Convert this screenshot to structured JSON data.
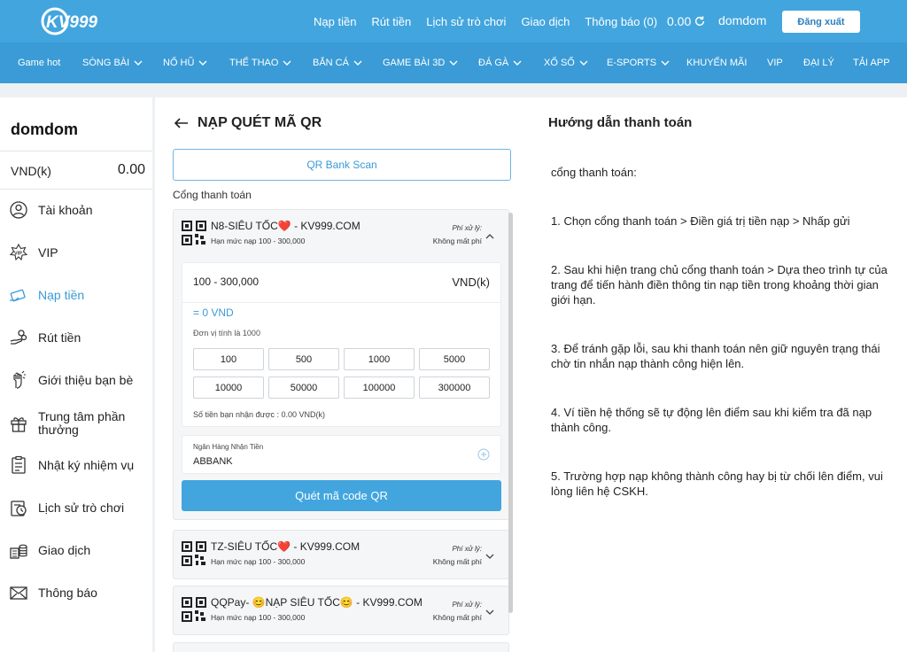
{
  "header": {
    "logo_text": "KV999",
    "links": [
      "Nạp tiền",
      "Rút tiền",
      "Lịch sử trò chơi",
      "Giao dịch",
      "Thông báo (0)"
    ],
    "balance": "0.00",
    "username": "domdom",
    "logout_label": "Đăng xuất"
  },
  "nav": {
    "items": [
      {
        "label": "Game hot",
        "chevron": false
      },
      {
        "label": "SÒNG BÀI",
        "chevron": true
      },
      {
        "label": "NỔ HŨ",
        "chevron": true
      },
      {
        "label": "THỂ THAO",
        "chevron": true
      },
      {
        "label": "BẮN CÁ",
        "chevron": true
      },
      {
        "label": "GAME BÀI 3D",
        "chevron": true
      },
      {
        "label": "ĐÁ GÀ",
        "chevron": true
      },
      {
        "label": "XỔ SỐ",
        "chevron": true
      },
      {
        "label": "E-SPORTS",
        "chevron": true
      },
      {
        "label": "KHUYẾN MÃI",
        "chevron": false
      },
      {
        "label": "VIP",
        "chevron": false
      },
      {
        "label": "ĐẠI LÝ",
        "chevron": false
      },
      {
        "label": "TẢI APP",
        "chevron": false
      }
    ]
  },
  "sidebar": {
    "username": "domdom",
    "currency_label": "VND(k)",
    "currency_value": "0.00",
    "items": [
      {
        "label": "Tài khoản",
        "icon": "account-icon"
      },
      {
        "label": "VIP",
        "icon": "vip-icon"
      },
      {
        "label": "Nạp tiền",
        "icon": "deposit-icon",
        "active": true
      },
      {
        "label": "Rút tiền",
        "icon": "withdraw-icon"
      },
      {
        "label": "Giới thiệu bạn bè",
        "icon": "referral-icon"
      },
      {
        "label": "Trung tâm phần thưởng",
        "icon": "gift-icon"
      },
      {
        "label": "Nhật ký nhiệm vụ",
        "icon": "task-log-icon"
      },
      {
        "label": "Lịch sử trò chơi",
        "icon": "game-history-icon"
      },
      {
        "label": "Giao dịch",
        "icon": "transaction-icon"
      },
      {
        "label": "Thông báo",
        "icon": "mail-icon"
      }
    ]
  },
  "main": {
    "title": "NẠP QUÉT MÃ QR",
    "tab_label": "QR Bank Scan",
    "gateway_label": "Cổng thanh toán",
    "gateways": [
      {
        "name": "N8-SIÊU TỐC❤️ - KV999.COM",
        "limit": "Hạn mức nạp 100 - 300,000",
        "fee_label": "Phí xử lý:",
        "fee_value": "Không mất phí",
        "expanded": true
      },
      {
        "name": "TZ-SIÊU TỐC❤️ - KV999.COM",
        "limit": "Hạn mức nạp 100 - 300,000",
        "fee_label": "Phí xử lý:",
        "fee_value": "Không mất phí",
        "expanded": false
      },
      {
        "name": "QQPay- 😊NẠP SIÊU TỐC😊 - KV999.COM",
        "limit": "Hạn mức nạp 100 - 300,000",
        "fee_label": "Phí xử lý:",
        "fee_value": "Không mất phí",
        "expanded": false
      }
    ],
    "amount": {
      "range_placeholder": "100 - 300,000",
      "currency": "VND(k)",
      "converted": "= 0 VND",
      "unit_note": "Đơn vị tính là 1000",
      "presets": [
        "100",
        "500",
        "1000",
        "5000",
        "10000",
        "50000",
        "100000",
        "300000"
      ],
      "receive_note": "Số tiền bạn nhận được : 0.00 VND(k)"
    },
    "bank": {
      "label": "Ngân Hàng Nhận Tiền",
      "value": "ABBANK"
    },
    "scan_button": "Quét mã code QR"
  },
  "guide": {
    "title": "Hướng dẫn thanh toán",
    "intro": "cổng thanh toán:",
    "steps": [
      "1. Chọn cổng thanh toán > Điền giá trị tiền nạp > Nhấp gửi",
      "2. Sau khi hiện trang chủ cổng thanh toán > Dựa theo trình tự của trang để tiến hành điền thông tin nạp tiền trong khoảng thời gian giới hạn.",
      "3. Để tránh gặp lỗi, sau khi thanh toán nên giữ nguyên trạng thái chờ tin nhắn nạp thành công hiện lên.",
      "4. Ví tiền hệ thống sẽ tự động lên điểm sau khi kiểm tra đã nạp thành công.",
      "5. Trường hợp nạp không thành công hay bị từ chối lên điểm, vui lòng liên hệ CSKH."
    ]
  }
}
